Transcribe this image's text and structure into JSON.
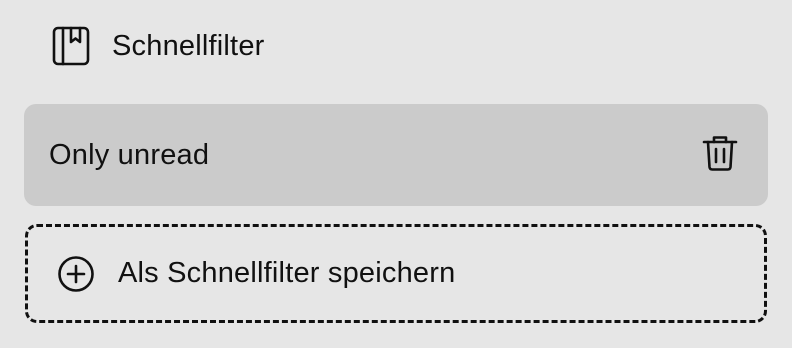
{
  "section": {
    "title": "Schnellfilter",
    "icon": "bookmark-book-icon"
  },
  "filters": [
    {
      "label": "Only unread",
      "delete_icon": "trash-icon"
    }
  ],
  "save_action": {
    "label": "Als Schnellfilter speichern",
    "icon": "plus-circle-icon"
  },
  "colors": {
    "background": "#e6e6e6",
    "item_background": "#cbcbcb",
    "text": "#111111"
  }
}
